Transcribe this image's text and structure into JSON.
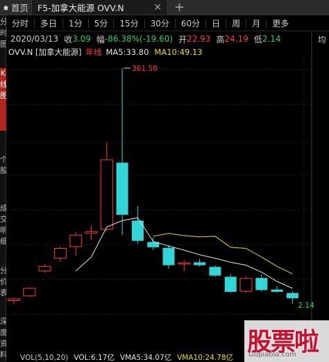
{
  "tabs": {
    "home": {
      "label": "首页",
      "icon": "home-icon"
    },
    "active": {
      "label": "F5-加拿大能源 OVV.N",
      "close": "✕"
    },
    "add": "+"
  },
  "left_strip": [
    "分时图",
    "K线图",
    "个股",
    "成交明细",
    "分价表",
    "深度资料"
  ],
  "periods": [
    "分时",
    "多日",
    "1分",
    "5分",
    "15分",
    "30分",
    "60分",
    "日",
    "周",
    "月",
    "更多"
  ],
  "right_axis_label": "均",
  "quote": {
    "date": "2020/03/13",
    "close_label": "收",
    "close": "3.09",
    "change_label": "幅",
    "change": "-86.38%(-19.60)",
    "open_label": "开",
    "open": "22.93",
    "high_label": "高",
    "high": "24.19",
    "low_label": "低",
    "low": "2.14"
  },
  "chart_header": {
    "name": "OVV.N [加拿大能源]",
    "period": "年线",
    "ma5": "MA5:33.80",
    "ma10": "MA10:49.13"
  },
  "chart_data": {
    "type": "candlestick",
    "annotations": [
      {
        "text": "361.58",
        "label": "max high"
      },
      {
        "text": "2.14",
        "label": "min low"
      }
    ],
    "colors": {
      "up": "#ff3b3b",
      "down": "#33d6d6",
      "ma5": "#e6e6e6",
      "ma10": "#e8e000",
      "grid": "#3a1a1a"
    },
    "candles": [
      {
        "o": 2.7,
        "h": 3.2,
        "l": 2.1,
        "c": 3.0
      },
      {
        "o": 3.5,
        "h": 5.0,
        "l": 3.3,
        "c": 4.8
      },
      {
        "o": 7.8,
        "h": 9.0,
        "l": 7.5,
        "c": 8.6
      },
      {
        "o": 10.0,
        "h": 12.0,
        "l": 9.4,
        "c": 11.7
      },
      {
        "o": 12.0,
        "h": 14.6,
        "l": 10.5,
        "c": 14.0
      },
      {
        "o": 14.3,
        "h": 15.6,
        "l": 13.2,
        "c": 14.6
      },
      {
        "o": 15.0,
        "h": 30.0,
        "l": 14.6,
        "c": 27.0
      },
      {
        "o": 26.5,
        "h": 361.58,
        "l": 14.0,
        "c": 17.5
      },
      {
        "o": 16.5,
        "h": 19.0,
        "l": 12.5,
        "c": 13.0
      },
      {
        "o": 12.8,
        "h": 13.6,
        "l": 11.4,
        "c": 11.9
      },
      {
        "o": 11.8,
        "h": 12.3,
        "l": 8.2,
        "c": 8.8
      },
      {
        "o": 9.0,
        "h": 9.6,
        "l": 7.8,
        "c": 9.2
      },
      {
        "o": 9.3,
        "h": 9.9,
        "l": 8.5,
        "c": 8.8
      },
      {
        "o": 8.5,
        "h": 8.8,
        "l": 6.8,
        "c": 7.0
      },
      {
        "o": 6.8,
        "h": 7.3,
        "l": 4.0,
        "c": 4.2
      },
      {
        "o": 4.3,
        "h": 6.9,
        "l": 4.1,
        "c": 6.5
      },
      {
        "o": 6.6,
        "h": 7.2,
        "l": 4.3,
        "c": 4.5
      },
      {
        "o": 4.6,
        "h": 5.2,
        "l": 4.0,
        "c": 4.2
      },
      {
        "o": 4.0,
        "h": 4.3,
        "l": 2.14,
        "c": 3.09
      }
    ],
    "ma5": [
      null,
      null,
      null,
      null,
      7.8,
      10.2,
      15.4,
      16.5,
      17.0,
      12.9,
      12.1,
      11.4,
      10.6,
      10.0,
      9.3,
      8.8,
      7.6,
      6.0,
      4.8
    ],
    "ma10": [
      null,
      null,
      null,
      null,
      null,
      null,
      null,
      null,
      null,
      13.8,
      14.3,
      13.9,
      13.7,
      13.8,
      11.9,
      11.7,
      10.2,
      8.6,
      7.3
    ]
  },
  "bottom_bar": {
    "vol": "VOL(5,10,20)",
    "v1": "VOL:6.17亿",
    "v2": "VMA5:34.07亿",
    "v3": "VMA10:24.78亿"
  },
  "watermark": {
    "text": "股票啦",
    "url": "Gupiaola.com"
  }
}
